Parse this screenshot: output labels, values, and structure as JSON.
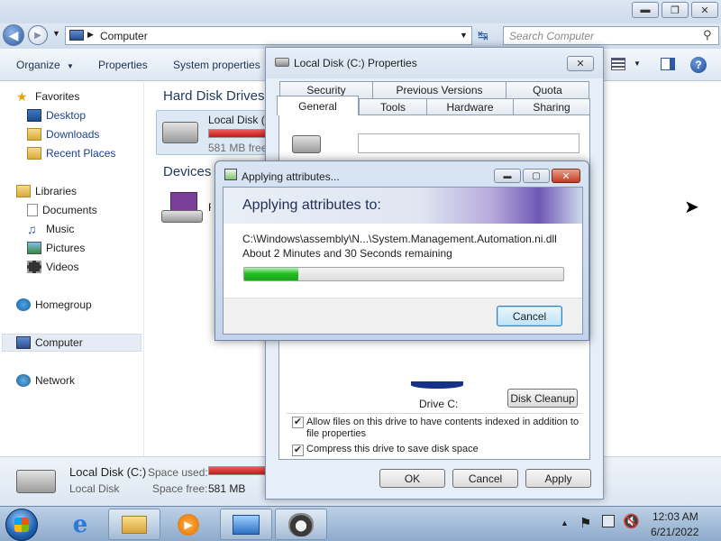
{
  "explorer": {
    "address_path": "Computer",
    "search_placeholder": "Search Computer",
    "toolbar": {
      "organize": "Organize",
      "properties": "Properties",
      "system_properties": "System properties"
    },
    "nav": {
      "favorites": "Favorites",
      "desktop": "Desktop",
      "downloads": "Downloads",
      "recent_places": "Recent Places",
      "libraries": "Libraries",
      "documents": "Documents",
      "music": "Music",
      "pictures": "Pictures",
      "videos": "Videos",
      "homegroup": "Homegroup",
      "computer": "Computer",
      "network": "Network"
    },
    "content": {
      "hard_disk_header": "Hard Disk Drives",
      "devices_header": "Devices with Removable Storage",
      "local_disk_label": "Local Disk (C:)",
      "local_disk_free": "581 MB free",
      "removable_label": "Floppy Disk Drive (A:)",
      "local_disk_used_fraction": 0.98
    },
    "details": {
      "name": "Local Disk (C:)",
      "type": "Local Disk",
      "space_used_label": "Space used:",
      "space_free_label": "Space free:",
      "space_free_value": "581 MB"
    }
  },
  "properties_dialog": {
    "title": "Local Disk (C:) Properties",
    "tabs_back": [
      "Security",
      "Previous Versions",
      "Quota"
    ],
    "tabs_front": [
      "General",
      "Tools",
      "Hardware",
      "Sharing"
    ],
    "active_tab": "General",
    "drive_label": "Drive C:",
    "disk_cleanup": "Disk Cleanup",
    "compress_label": "Compress this drive to save disk space",
    "compress_checked": true,
    "index_label": "Allow files on this drive to have contents indexed in addition to file properties",
    "index_checked": true,
    "ok": "OK",
    "cancel": "Cancel",
    "apply": "Apply"
  },
  "apply_dialog": {
    "title": "Applying attributes...",
    "heading": "Applying attributes to:",
    "file_path": "C:\\Windows\\assembly\\N...\\System.Management.Automation.ni.dll",
    "time_remaining": "About 2 Minutes and 30 Seconds remaining",
    "progress_fraction": 0.17,
    "cancel": "Cancel"
  },
  "taskbar": {
    "time": "12:03 AM",
    "date": "6/21/2022"
  },
  "colors": {
    "progress_green": "#22c022",
    "disk_bar_red": "#d9202a",
    "link_blue": "#1e3f8a"
  }
}
